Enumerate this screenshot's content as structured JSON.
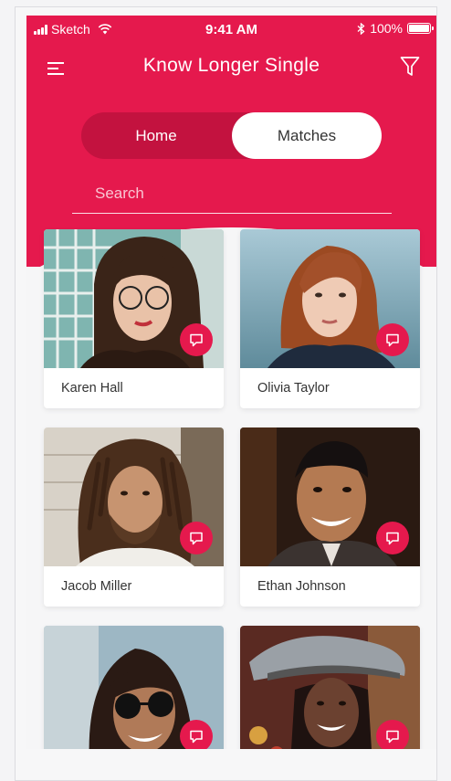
{
  "status_bar": {
    "carrier": "Sketch",
    "time": "9:41 AM",
    "battery": "100%"
  },
  "header": {
    "title": "Know Longer Single",
    "menu_icon": "hamburger-menu-icon",
    "filter_icon": "filter-funnel-icon"
  },
  "tabs": {
    "home_label": "Home",
    "matches_label": "Matches",
    "active": "Matches"
  },
  "search": {
    "placeholder": "Search",
    "value": ""
  },
  "matches": [
    {
      "name": "Karen Hall"
    },
    {
      "name": "Olivia Taylor"
    },
    {
      "name": "Jacob Miller"
    },
    {
      "name": "Ethan Johnson"
    },
    {
      "name": ""
    },
    {
      "name": ""
    }
  ],
  "colors": {
    "accent": "#e5194d",
    "accent_dark": "#c3123f",
    "background": "#f6f6f7"
  }
}
